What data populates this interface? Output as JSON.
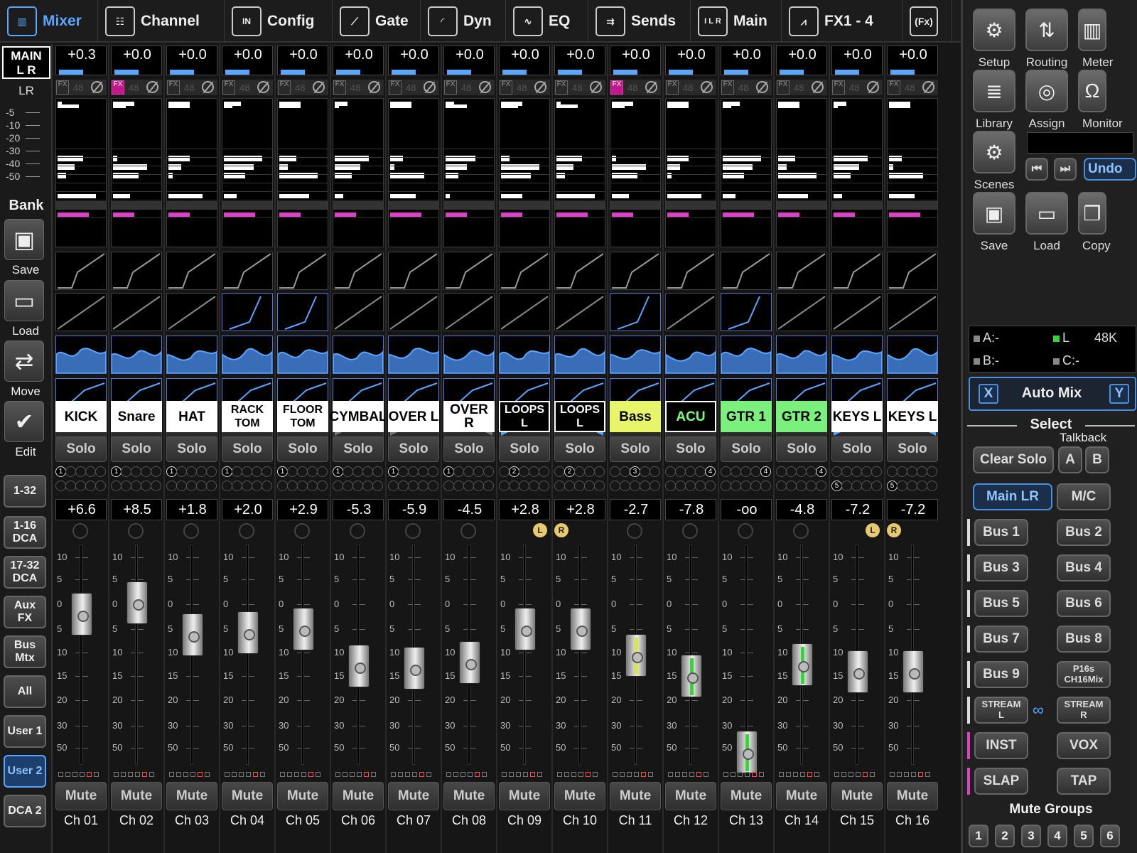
{
  "tabs": [
    {
      "label": "Mixer",
      "icon": "mixer-icon",
      "active": true
    },
    {
      "label": "Channel",
      "icon": "channel-icon"
    },
    {
      "label": "Config",
      "icon": "config-icon"
    },
    {
      "label": "Gate",
      "icon": "gate-icon"
    },
    {
      "label": "Dyn",
      "icon": "dynamics-icon"
    },
    {
      "label": "EQ",
      "icon": "eq-icon"
    },
    {
      "label": "Sends",
      "icon": "sends-icon"
    },
    {
      "label": "Main",
      "icon": "main-icon"
    },
    {
      "label": "FX1 - 4",
      "icon": "fx-icon"
    }
  ],
  "main_tab_icon_text": "I L R",
  "config_icon_text": "IN",
  "fx_overflow_label": "(Fx)",
  "left": {
    "main_lr_label": "MAIN\nL R",
    "lr_label": "LR",
    "lr_scale": [
      "-5",
      "-10",
      "-20",
      "-30",
      "-40",
      "-50"
    ],
    "bank_label": "Bank",
    "tools": [
      {
        "label": "Save",
        "icon": "save-icon"
      },
      {
        "label": "Load",
        "icon": "folder-icon"
      },
      {
        "label": "Move",
        "icon": "move-icon"
      },
      {
        "label": "Edit",
        "icon": "check-icon"
      }
    ],
    "banks": [
      "1-32",
      "1-16\nDCA",
      "17-32\nDCA",
      "Aux\nFX",
      "Bus\nMtx",
      "All",
      "User 1",
      "User 2",
      "DCA 2"
    ],
    "selected_bank": "User 2"
  },
  "fader_scale": [
    "10",
    "5",
    "0",
    "5",
    "10",
    "15",
    "20",
    "30",
    "50"
  ],
  "solo_label": "Solo",
  "mute_label": "Mute",
  "fx_tag": "FX",
  "phantom_label": "48",
  "channels": [
    {
      "ch": "Ch 01",
      "name": "KICK",
      "gain": "+0.3",
      "level": "+6.6",
      "fader": 0.74,
      "fx": false,
      "name_bg": "#ffffff",
      "name_fg": "#000000",
      "group": "1",
      "dyn_on": false,
      "eq_on": true,
      "pan": null
    },
    {
      "ch": "Ch 02",
      "name": "Snare",
      "gain": "+0.0",
      "level": "+8.5",
      "fader": 0.8,
      "fx": true,
      "name_bg": "#ffffff",
      "name_fg": "#000000",
      "group": "1",
      "dyn_on": false,
      "eq_on": true,
      "pan": null
    },
    {
      "ch": "Ch 03",
      "name": "HAT",
      "gain": "+0.0",
      "level": "+1.8",
      "fader": 0.63,
      "fx": false,
      "name_bg": "#ffffff",
      "name_fg": "#000000",
      "group": "1",
      "dyn_on": false,
      "eq_on": true,
      "pan": null
    },
    {
      "ch": "Ch 04",
      "name": "RACK\nTOM",
      "gain": "+0.0",
      "level": "+2.0",
      "fader": 0.64,
      "fx": false,
      "name_bg": "#ffffff",
      "name_fg": "#000000",
      "group": "1",
      "dyn_on": true,
      "eq_on": true,
      "pan": null
    },
    {
      "ch": "Ch 05",
      "name": "FLOOR\nTOM",
      "gain": "+0.0",
      "level": "+2.9",
      "fader": 0.66,
      "fx": false,
      "name_bg": "#ffffff",
      "name_fg": "#000000",
      "group": "1",
      "dyn_on": true,
      "eq_on": true,
      "pan": null
    },
    {
      "ch": "Ch 06",
      "name": "CYMBAL",
      "gain": "+0.0",
      "level": "-5.3",
      "fader": 0.46,
      "fx": false,
      "name_bg": "#ffffff",
      "name_fg": "#000000",
      "group": "1",
      "dyn_on": false,
      "eq_on": true,
      "pan": "right-gray"
    },
    {
      "ch": "Ch 07",
      "name": "OVER L",
      "gain": "+0.0",
      "level": "-5.9",
      "fader": 0.45,
      "fx": false,
      "name_bg": "#ffffff",
      "name_fg": "#000000",
      "group": "1",
      "dyn_on": false,
      "eq_on": true,
      "pan": "right-gray"
    },
    {
      "ch": "Ch 08",
      "name": "OVER R",
      "gain": "+0.0",
      "level": "-4.5",
      "fader": 0.48,
      "fx": false,
      "name_bg": "#ffffff",
      "name_fg": "#000000",
      "group": "1",
      "dyn_on": false,
      "eq_on": true,
      "pan": "left-gray"
    },
    {
      "ch": "Ch 09",
      "name": "LOOPS L",
      "gain": "+0.0",
      "level": "+2.8",
      "fader": 0.66,
      "fx": false,
      "name_bg": "#000000",
      "name_fg": "#ffffff",
      "group": "2",
      "dyn_on": false,
      "eq_on": true,
      "pan": "right",
      "stereo": "L"
    },
    {
      "ch": "Ch 10",
      "name": "LOOPS L",
      "gain": "+0.0",
      "level": "+2.8",
      "fader": 0.66,
      "fx": false,
      "name_bg": "#000000",
      "name_fg": "#ffffff",
      "group": "2",
      "dyn_on": false,
      "eq_on": true,
      "pan": "left",
      "stereo": "R"
    },
    {
      "ch": "Ch 11",
      "name": "Bass",
      "gain": "+0.0",
      "level": "-2.7",
      "fader": 0.52,
      "fx": true,
      "name_bg": "#e8f56a",
      "name_fg": "#000000",
      "group": "3",
      "dyn_on": true,
      "eq_on": true,
      "pan": null,
      "fader_color": "#d8e840"
    },
    {
      "ch": "Ch 12",
      "name": "ACU",
      "gain": "+0.0",
      "level": "-7.8",
      "fader": 0.41,
      "fx": false,
      "name_bg": "#000000",
      "name_fg": "#7cff7c",
      "group": "4",
      "dyn_on": false,
      "eq_on": true,
      "pan": null,
      "fader_color": "#39d23a"
    },
    {
      "ch": "Ch 13",
      "name": "GTR 1",
      "gain": "+0.0",
      "level": "-oo",
      "fader": 0.0,
      "fx": false,
      "name_bg": "#7cf07c",
      "name_fg": "#000000",
      "group": "4",
      "dyn_on": true,
      "eq_on": true,
      "pan": null,
      "fader_color": "#39d23a"
    },
    {
      "ch": "Ch 14",
      "name": "GTR 2",
      "gain": "+0.0",
      "level": "-4.8",
      "fader": 0.47,
      "fx": false,
      "name_bg": "#7cf07c",
      "name_fg": "#000000",
      "group": "4",
      "dyn_on": false,
      "eq_on": true,
      "pan": null,
      "fader_color": "#39d23a"
    },
    {
      "ch": "Ch 15",
      "name": "KEYS L",
      "gain": "+0.0",
      "level": "-7.2",
      "fader": 0.43,
      "fx": false,
      "name_bg": "#ffffff",
      "name_fg": "#000000",
      "group": "5",
      "dyn_on": false,
      "eq_on": true,
      "pan": "right",
      "stereo": "L"
    },
    {
      "ch": "Ch 16",
      "name": "KEYS L",
      "gain": "+0.0",
      "level": "-7.2",
      "fader": 0.43,
      "fx": false,
      "name_bg": "#ffffff",
      "name_fg": "#000000",
      "group": "5",
      "dyn_on": false,
      "eq_on": true,
      "pan": "left",
      "stereo": "R"
    }
  ],
  "right": {
    "tools": [
      {
        "label": "Setup",
        "icon": "gear-icon"
      },
      {
        "label": "Routing",
        "icon": "routing-icon"
      },
      {
        "label": "Meter",
        "icon": "meter-icon"
      },
      {
        "label": "Library",
        "icon": "library-icon"
      },
      {
        "label": "Assign",
        "icon": "assign-icon"
      },
      {
        "label": "Monitor",
        "icon": "headphones-icon"
      },
      {
        "label": "Scenes",
        "icon": "scenes-icon"
      },
      {
        "label": "Save",
        "icon": "save-icon"
      },
      {
        "label": "Load",
        "icon": "folder-icon"
      },
      {
        "label": "Copy",
        "icon": "copy-icon"
      }
    ],
    "undo_label": "Undo",
    "status": {
      "a": "A:-",
      "l": "L",
      "rate": "48K",
      "b": "B:-",
      "c": "C:-"
    },
    "automix": {
      "x": "X",
      "label": "Auto Mix",
      "y": "Y"
    },
    "select_label": "Select",
    "talkback_label": "Talkback",
    "clear_solo": "Clear Solo",
    "talk_a": "A",
    "talk_b": "B",
    "main_lr": "Main LR",
    "mc": "M/C",
    "buses": [
      "Bus 1",
      "Bus 2",
      "Bus 3",
      "Bus 4",
      "Bus 5",
      "Bus 6",
      "Bus 7",
      "Bus 8",
      "Bus 9",
      "P16s\nCH16Mix",
      "STREAM\nL",
      "STREAM\nR",
      "INST",
      "VOX",
      "SLAP",
      "TAP"
    ],
    "mute_groups_label": "Mute Groups",
    "mute_groups": [
      "1",
      "2",
      "3",
      "4",
      "5",
      "6"
    ]
  }
}
